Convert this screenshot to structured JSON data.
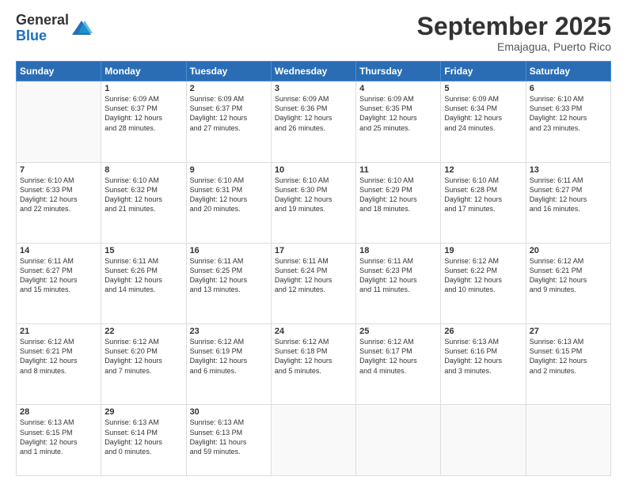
{
  "logo": {
    "general": "General",
    "blue": "Blue"
  },
  "header": {
    "month": "September 2025",
    "location": "Emajagua, Puerto Rico"
  },
  "weekdays": [
    "Sunday",
    "Monday",
    "Tuesday",
    "Wednesday",
    "Thursday",
    "Friday",
    "Saturday"
  ],
  "weeks": [
    [
      {
        "day": "",
        "info": ""
      },
      {
        "day": "1",
        "info": "Sunrise: 6:09 AM\nSunset: 6:37 PM\nDaylight: 12 hours\nand 28 minutes."
      },
      {
        "day": "2",
        "info": "Sunrise: 6:09 AM\nSunset: 6:37 PM\nDaylight: 12 hours\nand 27 minutes."
      },
      {
        "day": "3",
        "info": "Sunrise: 6:09 AM\nSunset: 6:36 PM\nDaylight: 12 hours\nand 26 minutes."
      },
      {
        "day": "4",
        "info": "Sunrise: 6:09 AM\nSunset: 6:35 PM\nDaylight: 12 hours\nand 25 minutes."
      },
      {
        "day": "5",
        "info": "Sunrise: 6:09 AM\nSunset: 6:34 PM\nDaylight: 12 hours\nand 24 minutes."
      },
      {
        "day": "6",
        "info": "Sunrise: 6:10 AM\nSunset: 6:33 PM\nDaylight: 12 hours\nand 23 minutes."
      }
    ],
    [
      {
        "day": "7",
        "info": "Sunrise: 6:10 AM\nSunset: 6:33 PM\nDaylight: 12 hours\nand 22 minutes."
      },
      {
        "day": "8",
        "info": "Sunrise: 6:10 AM\nSunset: 6:32 PM\nDaylight: 12 hours\nand 21 minutes."
      },
      {
        "day": "9",
        "info": "Sunrise: 6:10 AM\nSunset: 6:31 PM\nDaylight: 12 hours\nand 20 minutes."
      },
      {
        "day": "10",
        "info": "Sunrise: 6:10 AM\nSunset: 6:30 PM\nDaylight: 12 hours\nand 19 minutes."
      },
      {
        "day": "11",
        "info": "Sunrise: 6:10 AM\nSunset: 6:29 PM\nDaylight: 12 hours\nand 18 minutes."
      },
      {
        "day": "12",
        "info": "Sunrise: 6:10 AM\nSunset: 6:28 PM\nDaylight: 12 hours\nand 17 minutes."
      },
      {
        "day": "13",
        "info": "Sunrise: 6:11 AM\nSunset: 6:27 PM\nDaylight: 12 hours\nand 16 minutes."
      }
    ],
    [
      {
        "day": "14",
        "info": "Sunrise: 6:11 AM\nSunset: 6:27 PM\nDaylight: 12 hours\nand 15 minutes."
      },
      {
        "day": "15",
        "info": "Sunrise: 6:11 AM\nSunset: 6:26 PM\nDaylight: 12 hours\nand 14 minutes."
      },
      {
        "day": "16",
        "info": "Sunrise: 6:11 AM\nSunset: 6:25 PM\nDaylight: 12 hours\nand 13 minutes."
      },
      {
        "day": "17",
        "info": "Sunrise: 6:11 AM\nSunset: 6:24 PM\nDaylight: 12 hours\nand 12 minutes."
      },
      {
        "day": "18",
        "info": "Sunrise: 6:11 AM\nSunset: 6:23 PM\nDaylight: 12 hours\nand 11 minutes."
      },
      {
        "day": "19",
        "info": "Sunrise: 6:12 AM\nSunset: 6:22 PM\nDaylight: 12 hours\nand 10 minutes."
      },
      {
        "day": "20",
        "info": "Sunrise: 6:12 AM\nSunset: 6:21 PM\nDaylight: 12 hours\nand 9 minutes."
      }
    ],
    [
      {
        "day": "21",
        "info": "Sunrise: 6:12 AM\nSunset: 6:21 PM\nDaylight: 12 hours\nand 8 minutes."
      },
      {
        "day": "22",
        "info": "Sunrise: 6:12 AM\nSunset: 6:20 PM\nDaylight: 12 hours\nand 7 minutes."
      },
      {
        "day": "23",
        "info": "Sunrise: 6:12 AM\nSunset: 6:19 PM\nDaylight: 12 hours\nand 6 minutes."
      },
      {
        "day": "24",
        "info": "Sunrise: 6:12 AM\nSunset: 6:18 PM\nDaylight: 12 hours\nand 5 minutes."
      },
      {
        "day": "25",
        "info": "Sunrise: 6:12 AM\nSunset: 6:17 PM\nDaylight: 12 hours\nand 4 minutes."
      },
      {
        "day": "26",
        "info": "Sunrise: 6:13 AM\nSunset: 6:16 PM\nDaylight: 12 hours\nand 3 minutes."
      },
      {
        "day": "27",
        "info": "Sunrise: 6:13 AM\nSunset: 6:15 PM\nDaylight: 12 hours\nand 2 minutes."
      }
    ],
    [
      {
        "day": "28",
        "info": "Sunrise: 6:13 AM\nSunset: 6:15 PM\nDaylight: 12 hours\nand 1 minute."
      },
      {
        "day": "29",
        "info": "Sunrise: 6:13 AM\nSunset: 6:14 PM\nDaylight: 12 hours\nand 0 minutes."
      },
      {
        "day": "30",
        "info": "Sunrise: 6:13 AM\nSunset: 6:13 PM\nDaylight: 11 hours\nand 59 minutes."
      },
      {
        "day": "",
        "info": ""
      },
      {
        "day": "",
        "info": ""
      },
      {
        "day": "",
        "info": ""
      },
      {
        "day": "",
        "info": ""
      }
    ]
  ]
}
